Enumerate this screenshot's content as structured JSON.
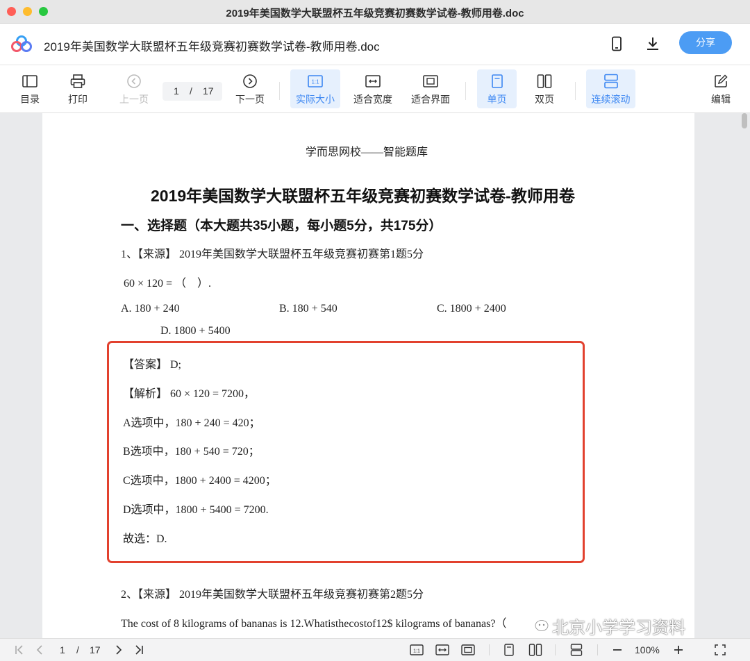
{
  "window": {
    "title": "2019年美国数学大联盟杯五年级竞赛初赛数学试卷-教师用卷.doc"
  },
  "header": {
    "doc_title": "2019年美国数学大联盟杯五年级竞赛初赛数学试卷-教师用卷.doc",
    "share_label": "分享",
    "icons": [
      "app-logo-icon",
      "phone-icon",
      "download-icon"
    ]
  },
  "toolbar": {
    "toc": "目录",
    "print": "打印",
    "prev": "上一页",
    "page_current": "1",
    "page_sep": "/",
    "page_total": "17",
    "next": "下一页",
    "actual_size": "实际大小",
    "fit_width": "适合宽度",
    "fit_page": "适合界面",
    "single_page": "单页",
    "double_page": "双页",
    "continuous": "连续滚动",
    "edit": "编辑"
  },
  "document": {
    "header": "学而思网校——智能题库",
    "title": "2019年美国数学大联盟杯五年级竞赛初赛数学试卷-教师用卷",
    "section": "一、选择题（本大题共35小题，每小题5分，共175分）",
    "q1": {
      "source": "1、【来源】 2019年美国数学大联盟杯五年级竞赛初赛第1题5分",
      "stem": "60 × 120 = （　）.",
      "opt_a": "A.  180 + 240",
      "opt_b": "B.  180 + 540",
      "opt_c": "C.  1800 + 2400",
      "opt_d": "D.  1800 + 5400"
    },
    "answer": {
      "line1": "【答案】 D;",
      "line2": "【解析】 60 × 120 = 7200，",
      "line3": "A选项中，180 + 240 = 420；",
      "line4": "B选项中，180 + 540 = 720；",
      "line5": "C选项中，1800 + 2400 = 4200；",
      "line6": "D选项中，1800 + 5400 = 7200.",
      "line7": "故选：D."
    },
    "q2": {
      "source": "2、【来源】 2019年美国数学大联盟杯五年级竞赛初赛第2题5分",
      "stem": "The cost of 8 kilograms of bananas is 12.Whatisthecostof12$ kilograms of bananas?（"
    }
  },
  "watermark": "北京小学学习资料",
  "statusbar": {
    "page_current": "1",
    "page_sep": "/",
    "page_total": "17",
    "zoom": "100%"
  },
  "colors": {
    "accent": "#3b86f2",
    "share_button": "#4c9cf4",
    "highlight_border": "#e2412e"
  }
}
